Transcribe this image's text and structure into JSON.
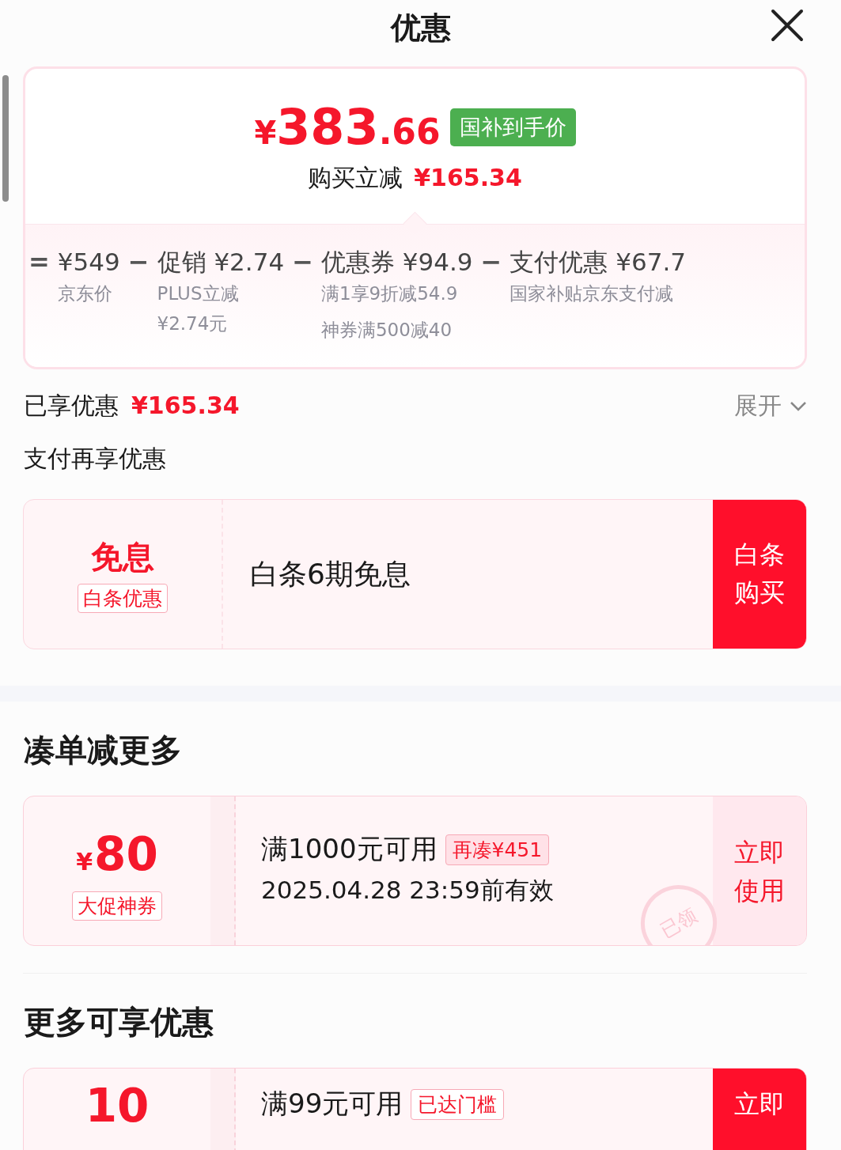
{
  "header": {
    "title": "优惠"
  },
  "price_card": {
    "currency": "¥",
    "integer": "383",
    "decimal": ".66",
    "badge": "国补到手价",
    "saving_label": "购买立减",
    "saving_amount": "¥165.34",
    "breakdown": [
      {
        "operator": "=",
        "title": "¥549",
        "notes": [
          "京东价"
        ]
      },
      {
        "operator": "−",
        "title": "促销 ¥2.74",
        "notes": [
          "PLUS立减",
          "¥2.74元"
        ]
      },
      {
        "operator": "−",
        "title": "优惠券 ¥94.9",
        "notes": [
          "满1享9折减54.9",
          "神券满500减40"
        ]
      },
      {
        "operator": "−",
        "title": "支付优惠 ¥67.7",
        "notes": [
          "国家补贴京东支付减"
        ]
      }
    ]
  },
  "enjoyed": {
    "label": "已享优惠",
    "amount": "¥165.34",
    "toggle": "展开",
    "expanded": false
  },
  "payment_section": {
    "title": "支付再享优惠",
    "card": {
      "headline": "免息",
      "tag": "白条优惠",
      "description": "白条6期免息",
      "button": [
        "白条",
        "购买"
      ]
    }
  },
  "sections": [
    {
      "title": "凑单减更多",
      "coupons": [
        {
          "kind": "claimed",
          "currency": "¥",
          "amount": "80",
          "tag": "大促神券",
          "condition": "满1000元可用",
          "badge": "再凑¥451",
          "validity": "2025.04.28 23:59前有效",
          "stamp": "已领",
          "action": [
            "立即",
            "使用"
          ]
        }
      ]
    },
    {
      "title": "更多可享优惠",
      "coupons": [
        {
          "kind": "reached",
          "amount": "10",
          "condition": "满99元可用",
          "badge": "已达门槛",
          "action": [
            "立即"
          ]
        }
      ]
    }
  ]
}
